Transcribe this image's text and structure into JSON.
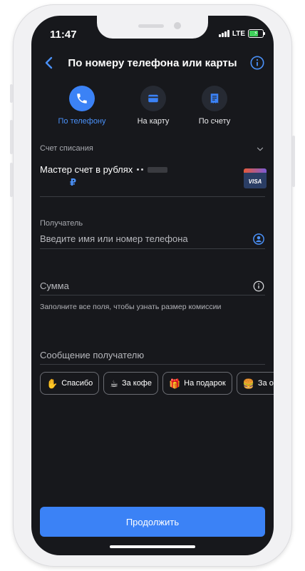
{
  "status_bar": {
    "time": "11:47",
    "network": "LTE",
    "battery_icon": "battery-charging-icon"
  },
  "header": {
    "title": "По номеру телефона или карты",
    "back_icon": "chevron-left-icon",
    "info_icon": "info-circle-icon"
  },
  "mode_tabs": [
    {
      "label": "По телефону",
      "icon": "phone-icon",
      "active": true
    },
    {
      "label": "На карту",
      "icon": "card-icon",
      "active": false
    },
    {
      "label": "По счету",
      "icon": "receipt-icon",
      "active": false
    }
  ],
  "debit_account": {
    "label": "Счет списания",
    "account_name": "Мастер счет в рублях",
    "currency_symbol": "₽",
    "card_brand": "VISA"
  },
  "recipient": {
    "label": "Получатель",
    "placeholder": "Введите имя или номер телефона",
    "value": ""
  },
  "amount": {
    "placeholder": "Сумма",
    "value": "",
    "hint": "Заполните все поля, чтобы узнать размер комиссии"
  },
  "message": {
    "placeholder": "Сообщение получателю",
    "value": ""
  },
  "quick_messages": [
    {
      "emoji": "✋",
      "label": "Спасибо"
    },
    {
      "emoji": "☕",
      "label": "За кофе"
    },
    {
      "emoji": "🎁",
      "label": "На подарок"
    },
    {
      "emoji": "🍔",
      "label": "За обед"
    }
  ],
  "continue_label": "Продолжить",
  "colors": {
    "accent": "#3b82f6",
    "background": "#17181c",
    "active_label": "#4a90f7"
  }
}
